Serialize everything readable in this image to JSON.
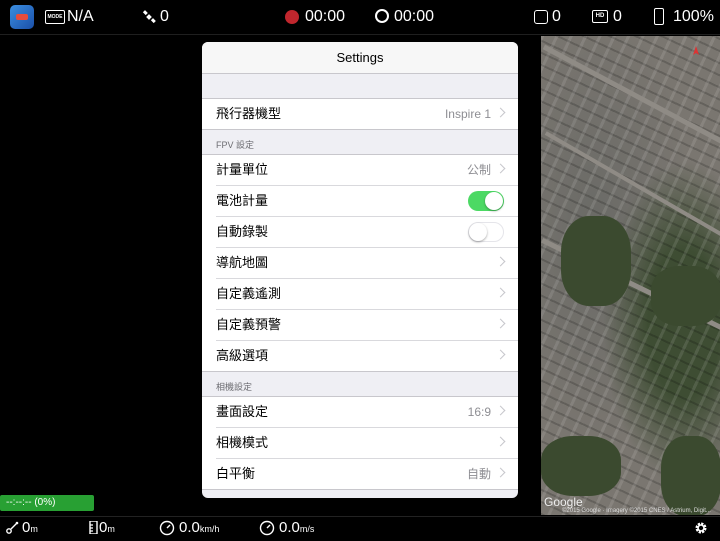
{
  "topbar": {
    "mode_icon_text": "MODE",
    "mode_value": "N/A",
    "satellite_count": "0",
    "recording_time": "00:00",
    "flight_time": "00:00",
    "rc_signal": "0",
    "hd_icon_text": "HD",
    "hd_signal": "0",
    "battery": "100%",
    "record_color": "#c0262d"
  },
  "map": {
    "logo": "Google",
    "credit": "©2015 Google · Imagery ©2015 CNES / Astrium, Digit..."
  },
  "settings": {
    "title": "Settings",
    "aircraft_row": {
      "label": "飛行器機型",
      "value": "Inspire 1"
    },
    "fpv_section_label": "FPV 設定",
    "fpv_rows": [
      {
        "label": "計量單位",
        "value": "公制"
      },
      {
        "label": "電池計量",
        "toggle": "on"
      },
      {
        "label": "自動錄製",
        "toggle": "off"
      },
      {
        "label": "導航地圖"
      },
      {
        "label": "自定義遙測"
      },
      {
        "label": "自定義預警"
      },
      {
        "label": "高級選項"
      }
    ],
    "camera_section_label": "相機設定",
    "camera_rows": [
      {
        "label": "畫面設定",
        "value": "16:9"
      },
      {
        "label": "相機模式"
      },
      {
        "label": "白平衡",
        "value": "自動"
      }
    ],
    "toggle_on_color": "#4cd964"
  },
  "status": {
    "battery_time": "--:--:-- (0%)",
    "battery_color": "#28a033"
  },
  "bottombar": {
    "distance_value": "0",
    "distance_unit": "m",
    "altitude_value": "0",
    "altitude_unit": "m",
    "hspeed_value": "0.0",
    "hspeed_unit": "km/h",
    "vspeed_value": "0.0",
    "vspeed_unit": "m/s"
  }
}
